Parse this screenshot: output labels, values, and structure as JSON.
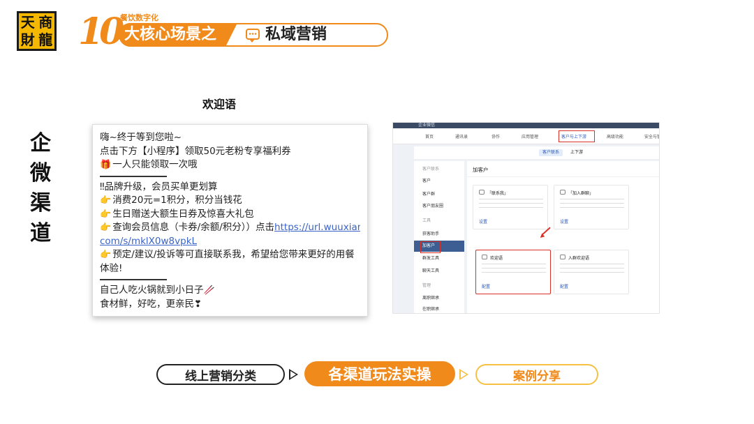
{
  "logo": {
    "chars": [
      "天",
      "商",
      "財",
      "龍"
    ]
  },
  "header": {
    "number": "10",
    "subtitle": "餐饮数字化",
    "title": "大核心场景之",
    "scene": "私域营销",
    "icon": "chat-icon"
  },
  "channel_label": [
    "企",
    "微",
    "渠",
    "道"
  ],
  "welcome": {
    "title": "欢迎语",
    "lines": {
      "l1": "嗨~终于等到您啦~",
      "l2": "点击下方【小程序】领取50元老粉专享福利券",
      "l3": "一人只能领取一次哦",
      "l4": "‼品牌升级，会员买单更划算",
      "l5": "消费20元=1积分，积分当钱花",
      "l6": "生日赠送大额生日券及惊喜大礼包",
      "l7a": "查询会员信息（卡券/余额/积分））点击",
      "l7_link1": "https://url.wuuxiang.",
      "l8_link2": "com/s/mklX0w8vpkL",
      "l9": "预定/建议/投诉等可直接联系我，希望给您带来更好的用餐",
      "l10": "体验!",
      "l11": "自己人吃火锅就到小日子",
      "l12": "食材鲜，好吃，更亲民"
    }
  },
  "screenshot": {
    "app_name": "企业微信",
    "nav": [
      "首页",
      "通讯录",
      "协作",
      "应用管理",
      "客户与上下游",
      "高级功能",
      "安全与管"
    ],
    "nav_active": "客户与上下游",
    "sub_tabs": [
      "客户联系",
      "上下游"
    ],
    "sidebar": [
      "客户联系",
      "客户",
      "客户群",
      "客户朋友圈",
      "工具",
      "获客助手",
      "加客户",
      "群发工具",
      "聊天工具",
      "管理",
      "离职继承",
      "在职继承"
    ],
    "sidebar_active": "加客户",
    "main_title": "加客户",
    "cards": [
      {
        "title": "「联系我」",
        "link": "设置"
      },
      {
        "title": "「加入群聊」",
        "link": "设置"
      },
      {
        "title": "欢迎语",
        "link": "配置"
      },
      {
        "title": "入群欢迎语",
        "link": "配置"
      }
    ]
  },
  "progress": {
    "steps": [
      "线上营销分类",
      "各渠道玩法实操",
      "案例分享"
    ],
    "active_step": 2
  },
  "colors": {
    "accent": "#f08a1a",
    "highlight": "#d93025",
    "link": "#3a63c8"
  }
}
